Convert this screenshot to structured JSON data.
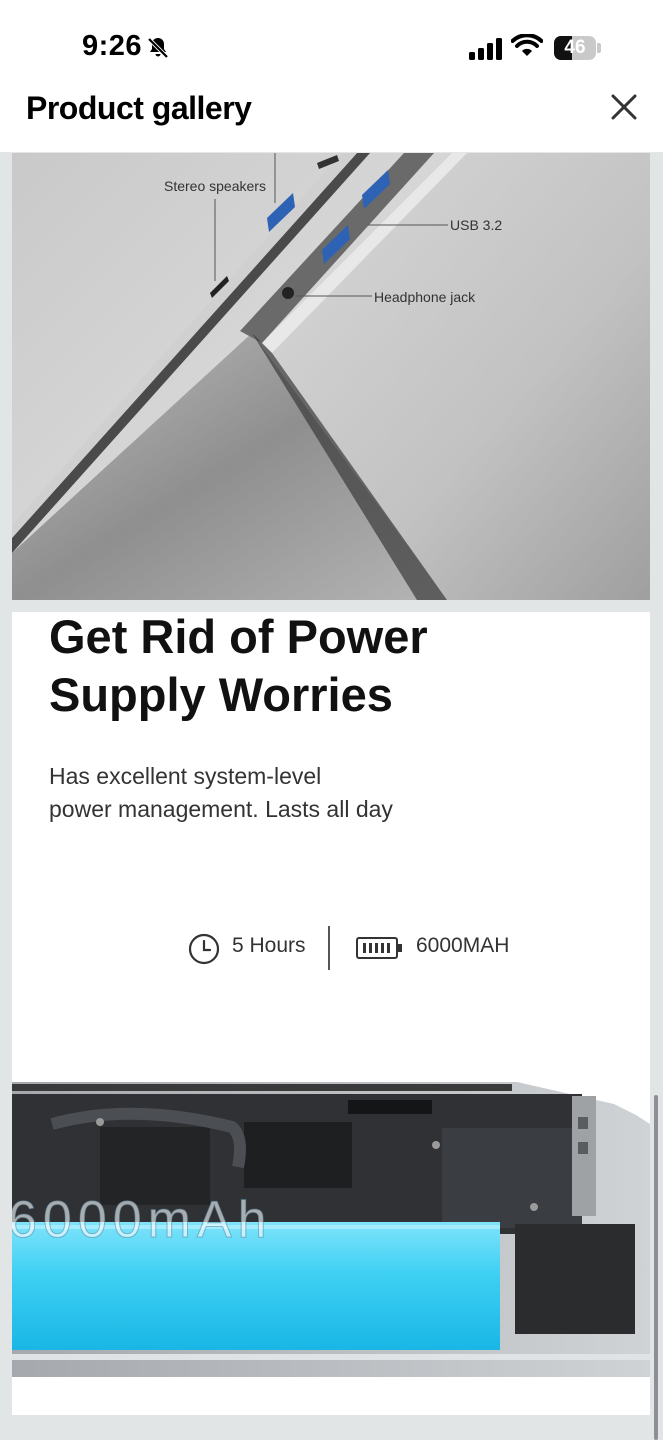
{
  "status_bar": {
    "time": "9:26",
    "battery_level": "46"
  },
  "header": {
    "title": "Product gallery"
  },
  "gallery": {
    "image1": {
      "callouts": {
        "speakers": "Stereo speakers",
        "usb": "USB 3.2",
        "headphone": "Headphone jack"
      }
    },
    "image2": {
      "headline_line1": "Get Rid of Power",
      "headline_line2": "Supply Worries",
      "desc_line1": "Has excellent system-level",
      "desc_line2": "power management. Lasts all day",
      "stat_hours": "5 Hours",
      "stat_capacity": "6000MAH",
      "battery_label": "6000mAh"
    }
  },
  "colors": {
    "battery_cyan": "#29c4ec",
    "background_gray": "#e2e5e6"
  }
}
